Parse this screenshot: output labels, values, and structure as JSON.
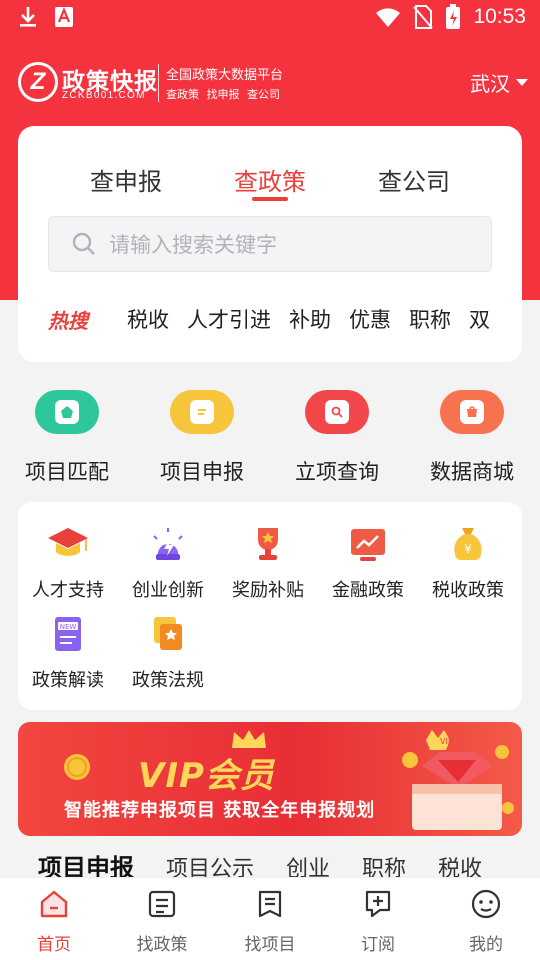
{
  "status_bar": {
    "time": "10:53"
  },
  "header": {
    "logo_mark": "Z",
    "logo_name": "政策快报",
    "logo_domain": "ZCKB001.COM",
    "platform": "全国政策大数据平台",
    "tagline": "查政策 找申报 查公司",
    "city": "武汉"
  },
  "search_card": {
    "tabs": [
      {
        "label": "查申报"
      },
      {
        "label": "查政策"
      },
      {
        "label": "查公司"
      }
    ],
    "active_tab": "查政策",
    "search_placeholder": "请输入搜索关键字",
    "hot_label": "热搜",
    "hot_terms": [
      "税收",
      "人才引进",
      "补助",
      "优惠",
      "职称",
      "双"
    ]
  },
  "quick_nav": [
    {
      "label": "项目匹配",
      "icon": "project-match-icon",
      "color": "#2ec69b"
    },
    {
      "label": "项目申报",
      "icon": "project-apply-icon",
      "color": "#f7c53b"
    },
    {
      "label": "立项查询",
      "icon": "project-query-icon",
      "color": "#f2474a"
    },
    {
      "label": "数据商城",
      "icon": "data-mall-icon",
      "color": "#f7734f"
    }
  ],
  "categories": [
    {
      "label": "人才支持",
      "icon": "graduation-cap-icon"
    },
    {
      "label": "创业创新",
      "icon": "lightning-icon"
    },
    {
      "label": "奖励补贴",
      "icon": "trophy-icon"
    },
    {
      "label": "金融政策",
      "icon": "finance-chart-icon"
    },
    {
      "label": "税收政策",
      "icon": "money-bag-icon"
    },
    {
      "label": "政策解读",
      "icon": "new-document-icon"
    },
    {
      "label": "政策法规",
      "icon": "regulation-icon"
    }
  ],
  "banner": {
    "title": "VIP会员",
    "subtitle": "智能推荐申报项目  获取全年申报规划"
  },
  "sub_tabs": [
    "项目申报",
    "项目公示",
    "创业",
    "职称",
    "税收"
  ],
  "bottom_nav": [
    {
      "label": "首页",
      "icon": "home-icon"
    },
    {
      "label": "找政策",
      "icon": "policy-icon"
    },
    {
      "label": "找项目",
      "icon": "project-icon"
    },
    {
      "label": "订阅",
      "icon": "subscribe-icon"
    },
    {
      "label": "我的",
      "icon": "profile-icon"
    }
  ],
  "colors": {
    "brand_red": "#f5333f",
    "accent": "#e8413c"
  }
}
